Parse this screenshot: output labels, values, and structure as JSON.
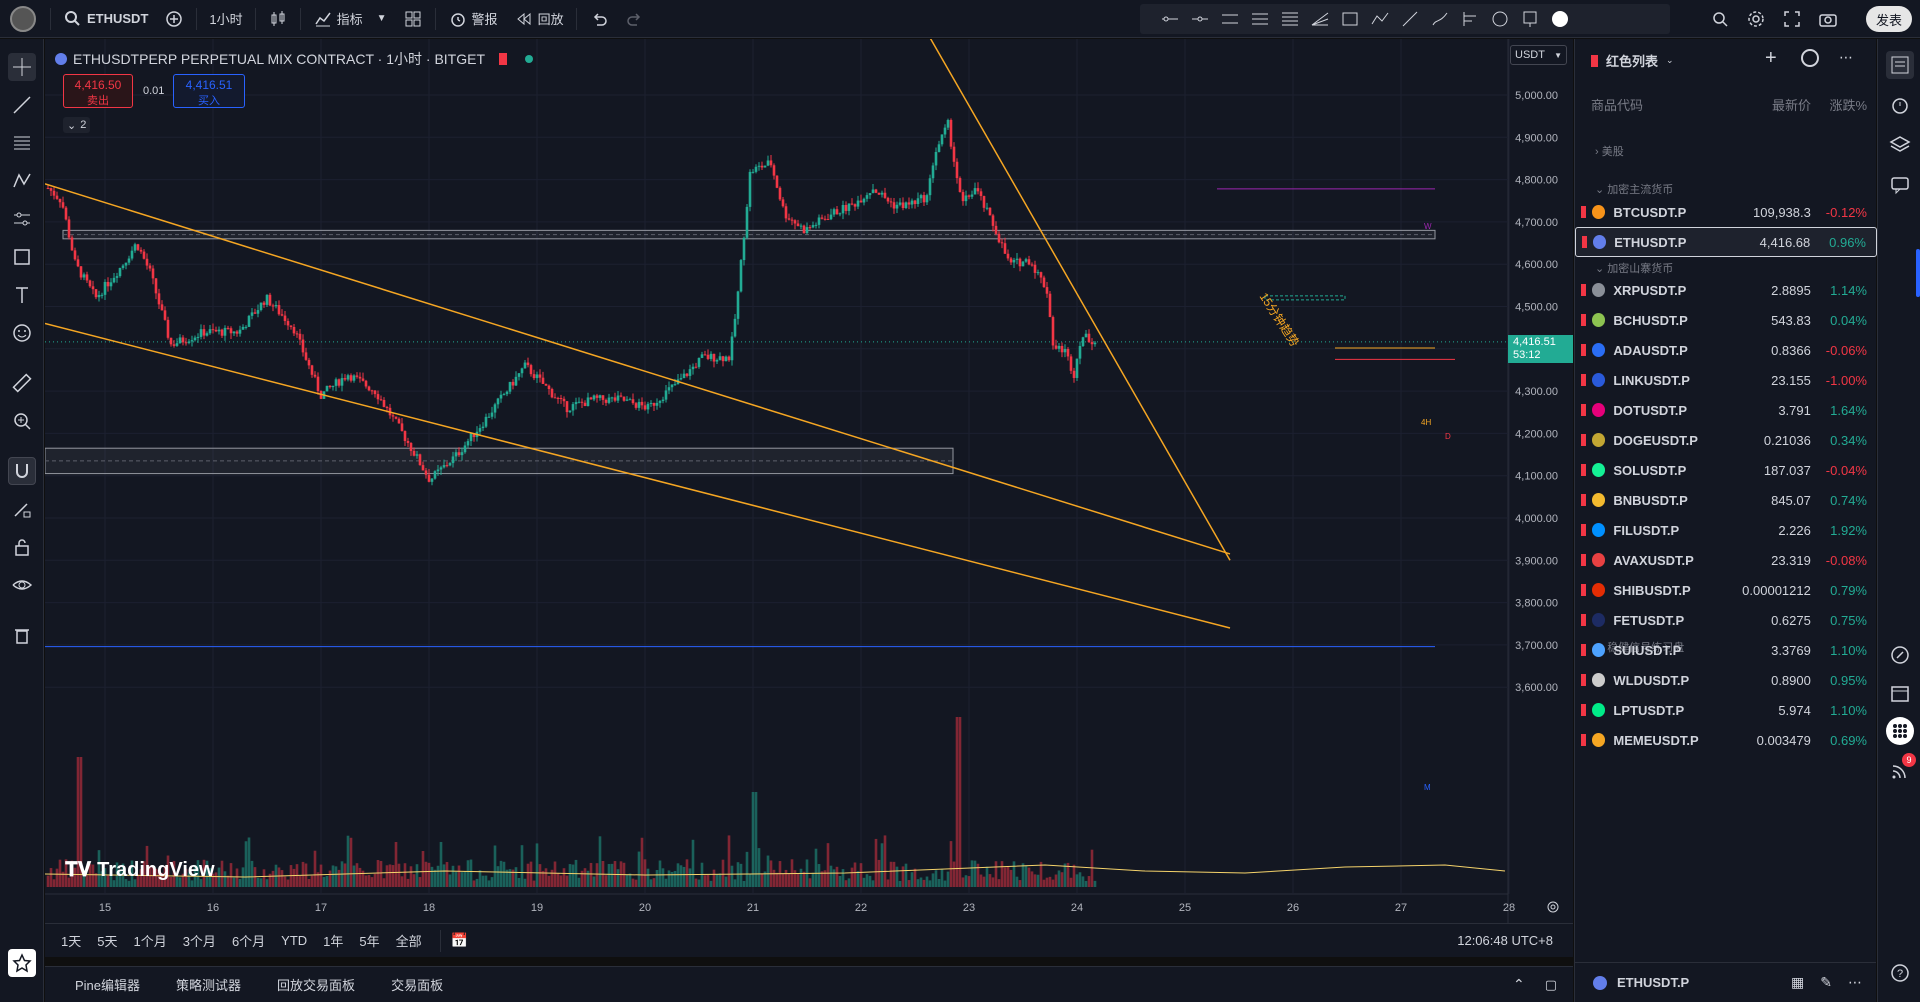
{
  "topbar": {
    "symbol": "ETHUSDT",
    "interval": "1小时",
    "indicators_label": "指标",
    "alert_label": "警报",
    "replay_label": "回放",
    "publish_label": "发表"
  },
  "legend": {
    "title": "ETHUSDTPERP PERPETUAL MIX CONTRACT · 1小时 · BITGET",
    "sell_price": "4,416.50",
    "sell_label": "卖出",
    "spread": "0.01",
    "buy_price": "4,416.51",
    "buy_label": "买入",
    "collapse_count": "2"
  },
  "price_scale": {
    "currency": "USDT",
    "ticks": [
      "5,000.00",
      "4,900.00",
      "4,800.00",
      "4,700.00",
      "4,600.00",
      "4,500.00",
      "4,400.00",
      "4,300.00",
      "4,200.00",
      "4,100.00",
      "4,000.00",
      "3,900.00",
      "3,800.00",
      "3,700.00",
      "3,600.00"
    ],
    "last_price": "4,416.51",
    "countdown": "53:12",
    "last_color": "#22ab94"
  },
  "time_scale": {
    "ticks": [
      "15",
      "16",
      "17",
      "18",
      "19",
      "20",
      "21",
      "22",
      "23",
      "24",
      "25",
      "26",
      "27",
      "28"
    ]
  },
  "drawings": {
    "trendline_label": "15分钟趋势",
    "tag_w": "W",
    "tag_4h": "4H",
    "tag_d": "D",
    "tag_m": "M"
  },
  "watermark": "TradingView",
  "timeframes": [
    "1天",
    "5天",
    "1个月",
    "3个月",
    "6个月",
    "YTD",
    "1年",
    "5年",
    "全部"
  ],
  "clock": "12:06:48 UTC+8",
  "bottom_panels": [
    "Pine编辑器",
    "策略测试器",
    "回放交易面板",
    "交易面板"
  ],
  "watchlist": {
    "title": "红色列表",
    "col_symbol": "商品代码",
    "col_price": "最新价",
    "col_change": "涨跌%",
    "sections": [
      "美股",
      "加密主流货币",
      "加密山寨货币",
      "稳健信号练习盘"
    ],
    "rows": [
      {
        "symbol": "BTCUSDT.P",
        "price": "109,938.3",
        "change": "-0.12%",
        "dir": "neg",
        "coin": "#f7931a"
      },
      {
        "symbol": "ETHUSDT.P",
        "price": "4,416.68",
        "change": "0.96%",
        "dir": "pos",
        "coin": "#627eea"
      },
      {
        "symbol": "XRPUSDT.P",
        "price": "2.8895",
        "change": "1.14%",
        "dir": "pos",
        "coin": "#8a8f98"
      },
      {
        "symbol": "BCHUSDT.P",
        "price": "543.83",
        "change": "0.04%",
        "dir": "pos",
        "coin": "#8dc351"
      },
      {
        "symbol": "ADAUSDT.P",
        "price": "0.8366",
        "change": "-0.06%",
        "dir": "neg",
        "coin": "#2a6df4"
      },
      {
        "symbol": "LINKUSDT.P",
        "price": "23.155",
        "change": "-1.00%",
        "dir": "neg",
        "coin": "#2a5ada"
      },
      {
        "symbol": "DOTUSDT.P",
        "price": "3.791",
        "change": "1.64%",
        "dir": "pos",
        "coin": "#e6007a"
      },
      {
        "symbol": "DOGEUSDT.P",
        "price": "0.21036",
        "change": "0.34%",
        "dir": "pos",
        "coin": "#c2a633"
      },
      {
        "symbol": "SOLUSDT.P",
        "price": "187.037",
        "change": "-0.04%",
        "dir": "neg",
        "coin": "#14f195"
      },
      {
        "symbol": "BNBUSDT.P",
        "price": "845.07",
        "change": "0.74%",
        "dir": "pos",
        "coin": "#f3ba2f"
      },
      {
        "symbol": "FILUSDT.P",
        "price": "2.226",
        "change": "1.92%",
        "dir": "pos",
        "coin": "#0090ff"
      },
      {
        "symbol": "AVAXUSDT.P",
        "price": "23.319",
        "change": "-0.08%",
        "dir": "neg",
        "coin": "#e84142"
      },
      {
        "symbol": "SHIBUSDT.P",
        "price": "0.00001212",
        "change": "0.79%",
        "dir": "pos",
        "coin": "#e42d04"
      },
      {
        "symbol": "FETUSDT.P",
        "price": "0.6275",
        "change": "0.75%",
        "dir": "pos",
        "coin": "#1d2b63"
      },
      {
        "symbol": "SUIUSDT.P",
        "price": "3.3769",
        "change": "1.10%",
        "dir": "pos",
        "coin": "#4da2ff"
      },
      {
        "symbol": "WLDUSDT.P",
        "price": "0.8900",
        "change": "0.95%",
        "dir": "pos",
        "coin": "#cccccc"
      },
      {
        "symbol": "LPTUSDT.P",
        "price": "5.974",
        "change": "1.10%",
        "dir": "pos",
        "coin": "#00eb88"
      },
      {
        "symbol": "MEMEUSDT.P",
        "price": "0.003479",
        "change": "0.69%",
        "dir": "pos",
        "coin": "#f5a623"
      }
    ]
  },
  "details": {
    "symbol": "ETHUSDT.P"
  },
  "notification_count": "9"
}
